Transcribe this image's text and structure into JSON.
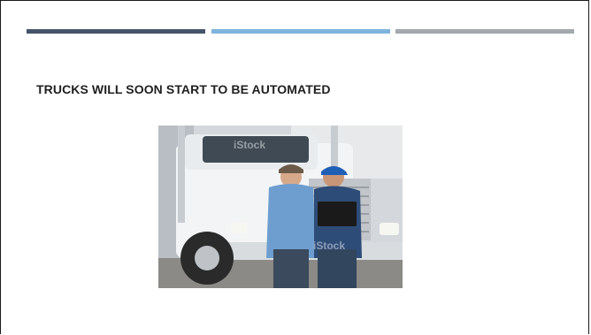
{
  "slide": {
    "title": "TRUCKS WILL SOON START TO BE AUTOMATED",
    "accent_bars": [
      {
        "color": "#44546a"
      },
      {
        "color": "#7fb4de"
      },
      {
        "color": "#a3a9ae"
      }
    ],
    "image": {
      "description_icon": "photo-truck-drivers",
      "watermark": "iStock"
    }
  }
}
